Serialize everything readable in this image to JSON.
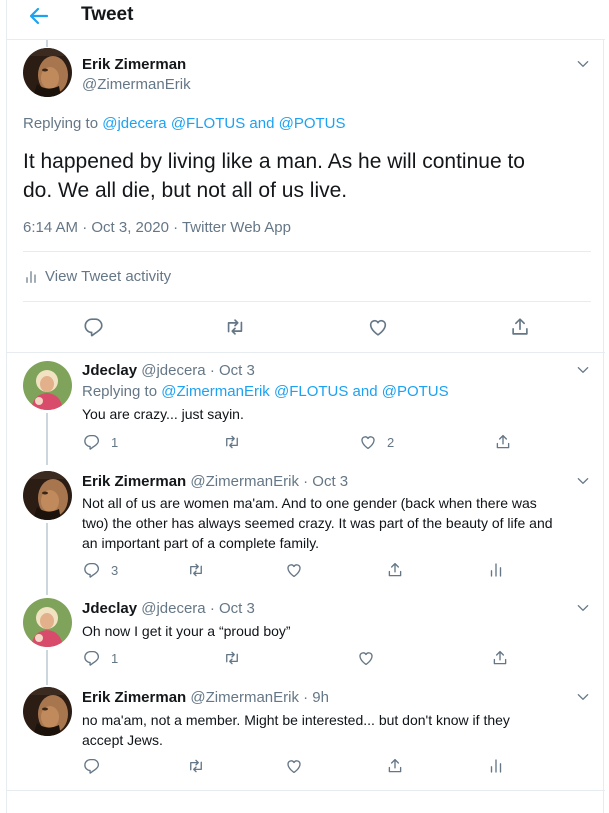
{
  "header": {
    "title": "Tweet"
  },
  "main_tweet": {
    "author_name": "Erik Zimerman",
    "author_handle": "@ZimermanErik",
    "replying_prefix": "Replying to",
    "reply_to_1": "@jdecera",
    "reply_to_2": "@FLOTUS",
    "reply_and": "and",
    "reply_to_3": "@POTUS",
    "text_line1": "It happened by living like a man. As he will continue to",
    "text_line2": "do. We all die, but not all of us live.",
    "meta": "6:14 AM · Oct 3, 2020 · Twitter Web App",
    "activity_label": "View Tweet activity"
  },
  "replies": [
    {
      "author_name": "Jdeclay",
      "author_handle": "@jdecera",
      "time": "· Oct 3",
      "replying_prefix": "Replying to",
      "reply_to_1": "@ZimermanErik",
      "reply_to_2": "@FLOTUS",
      "reply_and": "and",
      "reply_to_3": "@POTUS",
      "text": [
        "You are crazy... just sayin."
      ],
      "reply_count": "1",
      "like_count": "2"
    },
    {
      "author_name": "Erik Zimerman",
      "author_handle": "@ZimermanErik",
      "time": "· Oct 3",
      "text": [
        "Not all of us are women ma'am. And to one gender (back when there was",
        "two) the other has always seemed crazy. It was part of the beauty of life and",
        "an important part of a complete family."
      ],
      "reply_count": "3"
    },
    {
      "author_name": "Jdeclay",
      "author_handle": "@jdecera",
      "time": "· Oct 3",
      "text": [
        "Oh now I get it your a “proud boy”"
      ],
      "reply_count": "1"
    },
    {
      "author_name": "Erik Zimerman",
      "author_handle": "@ZimermanErik",
      "time": "· 9h",
      "text": [
        "no ma'am, not a member. Might be interested... but don't know if they",
        "accept Jews."
      ]
    }
  ],
  "colors": {
    "accent": "#1da1f2",
    "muted": "#657786",
    "border": "#e6ecf0"
  },
  "icons": [
    "back-arrow-icon",
    "chevron-down-icon",
    "reply-icon",
    "retweet-icon",
    "like-icon",
    "share-icon",
    "analytics-icon"
  ]
}
